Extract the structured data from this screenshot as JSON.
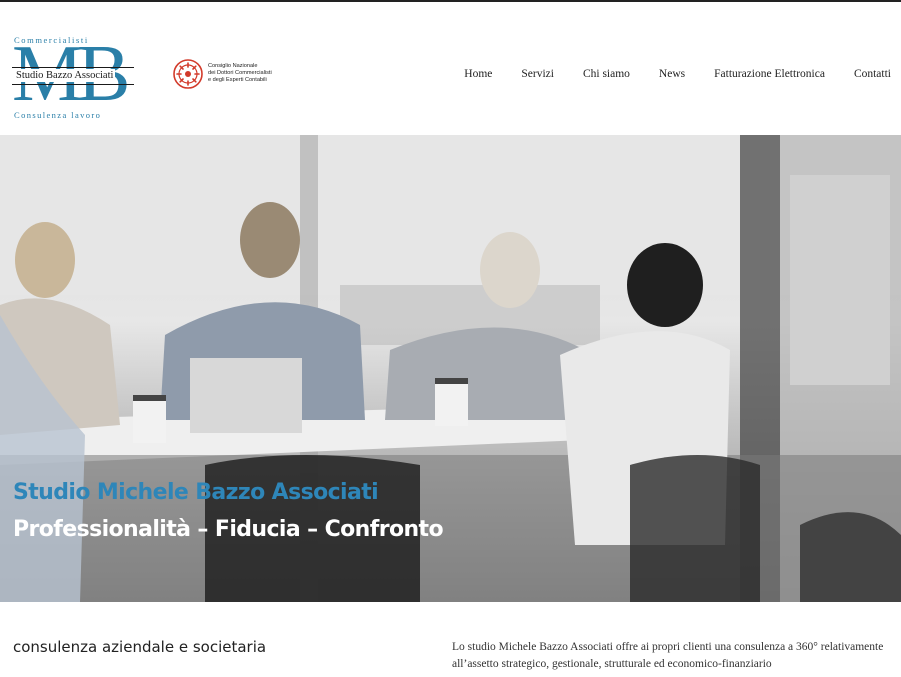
{
  "logo": {
    "top_text": "Commercialisti",
    "letters": "MB",
    "name": "Studio Bazzo Associati",
    "bottom_text": "Consulenza lavoro"
  },
  "cndcec": {
    "line1": "Consiglio Nazionale",
    "line2": "dei Dottori Commercialisti",
    "line3": "e degli Esperti Contabili"
  },
  "nav": {
    "items": [
      "Home",
      "Servizi",
      "Chi siamo",
      "News",
      "Fatturazione Elettronica",
      "Contatti"
    ]
  },
  "hero": {
    "title": "Studio Michele Bazzo Associati",
    "subtitle": "Professionalità – Fiducia – Confronto"
  },
  "content": {
    "heading": "consulenza aziendale e societaria",
    "paragraph": "Lo studio Michele Bazzo Associati offre ai propri clienti una consulenza a 360° relativamente all’assetto strategico, gestionale, strutturale ed economico-finanziario"
  },
  "colors": {
    "accent": "#2e86b9",
    "seal": "#d23a2a"
  }
}
